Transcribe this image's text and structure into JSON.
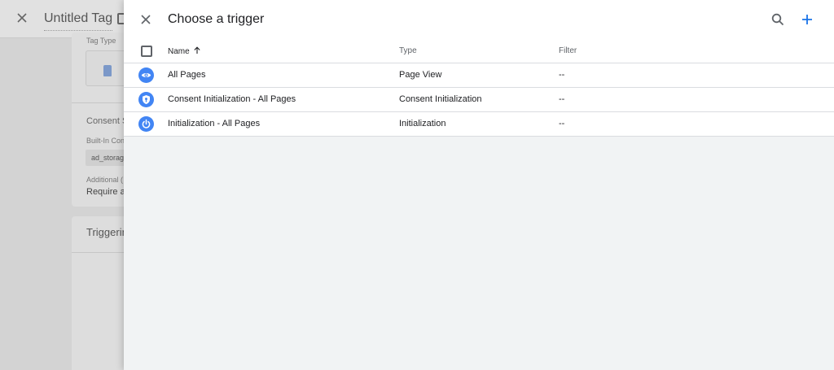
{
  "background": {
    "title": "Untitled Tag",
    "tag_type_label": "Tag Type",
    "consent_label": "Consent S",
    "builtin_label": "Built-In Con",
    "chip": "ad_storag",
    "additional_label": "Additional (",
    "require_text": "Require ac",
    "triggering_label": "Triggerin"
  },
  "modal": {
    "title": "Choose a trigger",
    "columns": {
      "name": "Name",
      "type": "Type",
      "filter": "Filter"
    },
    "rows": [
      {
        "icon": "eye-icon",
        "name": "All Pages",
        "type": "Page View",
        "filter": "--"
      },
      {
        "icon": "consent-icon",
        "name": "Consent Initialization - All Pages",
        "type": "Consent Initialization",
        "filter": "--"
      },
      {
        "icon": "power-icon",
        "name": "Initialization - All Pages",
        "type": "Initialization",
        "filter": "--"
      }
    ]
  },
  "colors": {
    "accent": "#1a73e8",
    "icon_bg": "#4285f4",
    "overlay": "#d3d3d3",
    "panel_bg": "#f1f3f4"
  }
}
